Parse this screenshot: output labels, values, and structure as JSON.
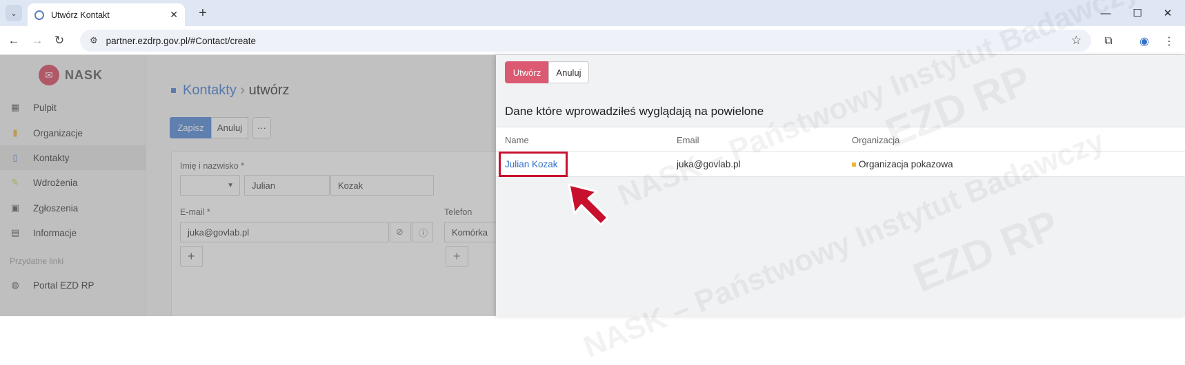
{
  "browser": {
    "tab_title": "Utwórz Kontakt",
    "url": "partner.ezdrp.gov.pl/#Contact/create"
  },
  "sidebar": {
    "logo_text": "NASK",
    "items": [
      {
        "label": "Pulpit",
        "icon": "grid-icon"
      },
      {
        "label": "Organizacje",
        "icon": "bookmark-icon"
      },
      {
        "label": "Kontakty",
        "icon": "contact-card-icon"
      },
      {
        "label": "Wdrożenia",
        "icon": "pencil-icon"
      },
      {
        "label": "Zgłoszenia",
        "icon": "briefcase-icon"
      },
      {
        "label": "Informacje",
        "icon": "book-icon"
      }
    ],
    "section_label": "Przydatne linki",
    "links": [
      {
        "label": "Portal EZD RP"
      }
    ]
  },
  "main": {
    "breadcrumb_link": "Kontakty",
    "breadcrumb_sep": "›",
    "breadcrumb_current": "utwórz",
    "buttons": {
      "save": "Zapisz",
      "cancel": "Anuluj",
      "more": "···"
    },
    "form": {
      "name_label": "Imię i nazwisko *",
      "first_name": "Julian",
      "last_name": "Kozak",
      "email_label": "E-mail *",
      "email": "juka@govlab.pl",
      "phone_label": "Telefon",
      "phone_type": "Komórka"
    }
  },
  "panel": {
    "buttons": {
      "create": "Utwórz",
      "cancel": "Anuluj"
    },
    "title": "Dane które wprowadziłeś wyglądają na powielone",
    "columns": [
      "Name",
      "Email",
      "Organizacja"
    ],
    "rows": [
      {
        "name": "Julian Kozak",
        "email": "juka@govlab.pl",
        "organization": "Organizacja pokazowa"
      }
    ]
  },
  "watermark": "NASK – Państwowy Instytut Badawczy",
  "watermark_logo": "EZD RP",
  "colors": {
    "accent_red": "#d9435b",
    "primary_blue": "#4e86d6",
    "highlight": "#c8102e"
  }
}
